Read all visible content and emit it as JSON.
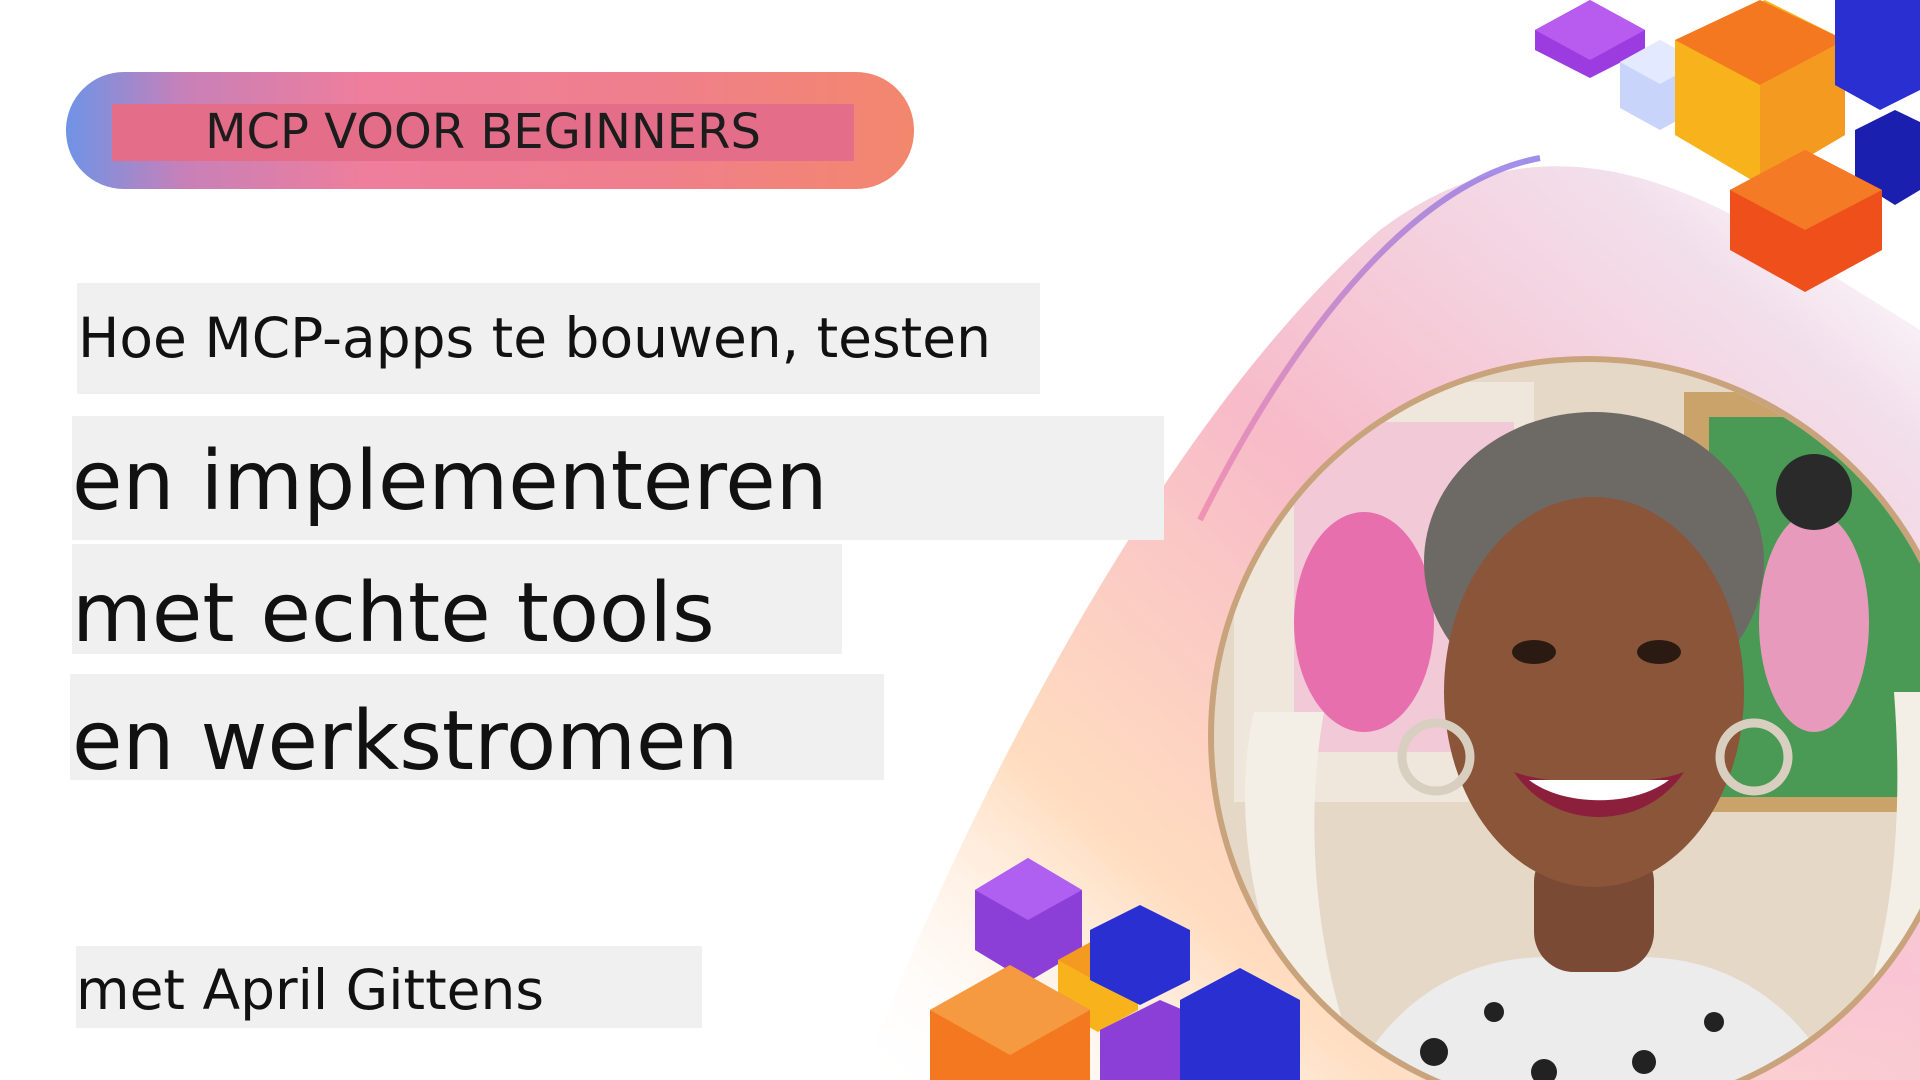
{
  "badge": {
    "label": "MCP VOOR BEGINNERS"
  },
  "title": {
    "line1": "Hoe MCP-apps te bouwen, testen",
    "line2": "en implementeren",
    "line3": "met echte tools",
    "line4": "en werkstromen"
  },
  "presenter": {
    "byline": "met April Gittens"
  },
  "colors": {
    "badge_gradient": [
      "#6f93e6",
      "#ee7e9c",
      "#f3876d"
    ],
    "cube_purple": "#8b3fd6",
    "cube_orange": "#f4781f",
    "cube_blue": "#2a2fd1",
    "cube_yellow": "#f7b21c"
  },
  "icons": [
    "hexagon-cube-cluster-top",
    "hexagon-cube-cluster-bottom",
    "presenter-photo"
  ]
}
